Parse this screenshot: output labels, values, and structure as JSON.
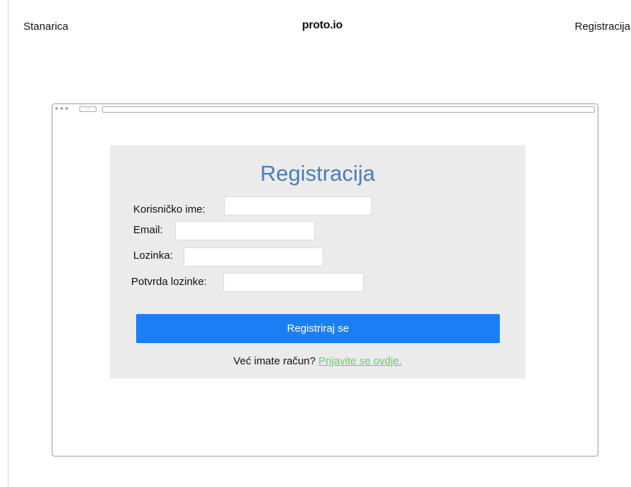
{
  "topbar": {
    "left_label": "Stanarica",
    "brand": "proto.io",
    "right_label": "Registracija"
  },
  "browser": {
    "nav_glyph": "‹ ›"
  },
  "form": {
    "title": "Registracija",
    "fields": [
      {
        "label": "Korisničko ime:",
        "value": ""
      },
      {
        "label": "Email:",
        "value": ""
      },
      {
        "label": "Lozinka:",
        "value": ""
      },
      {
        "label": "Potvrda lozinke:",
        "value": ""
      }
    ],
    "submit_label": "Registriraj se",
    "login_prompt": "Već imate račun?",
    "login_link": "Prijavite se ovdje.",
    "colors": {
      "title": "#4a7fb8",
      "button": "#1a7ff5",
      "link": "#6cc96c",
      "panel": "#ebebeb"
    }
  }
}
